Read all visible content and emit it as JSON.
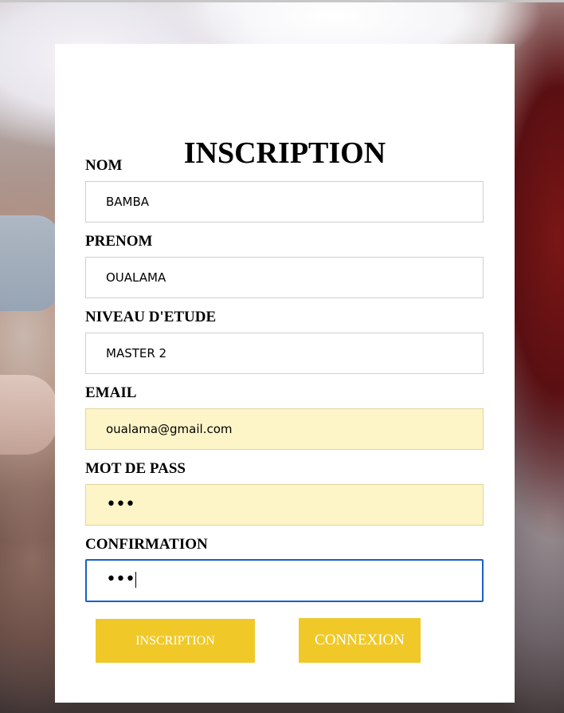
{
  "form": {
    "title": "INSCRIPTION",
    "fields": [
      {
        "label": "NOM",
        "value": "BAMBA"
      },
      {
        "label": "PRENOM",
        "value": "OUALAMA"
      },
      {
        "label": "NIVEAU D'ETUDE",
        "value": "MASTER 2"
      },
      {
        "label": "EMAIL",
        "value": "oualama@gmail.com"
      },
      {
        "label": "MOT DE PASS",
        "value": "•••"
      },
      {
        "label": "CONFIRMATION",
        "value": "•••"
      }
    ],
    "buttons": {
      "inscription": "INSCRIPTION",
      "connexion": "CONNEXION"
    }
  },
  "colors": {
    "button": "#f0c929",
    "autofill": "#fdf5c8",
    "focus_border": "#1a5fc8"
  }
}
